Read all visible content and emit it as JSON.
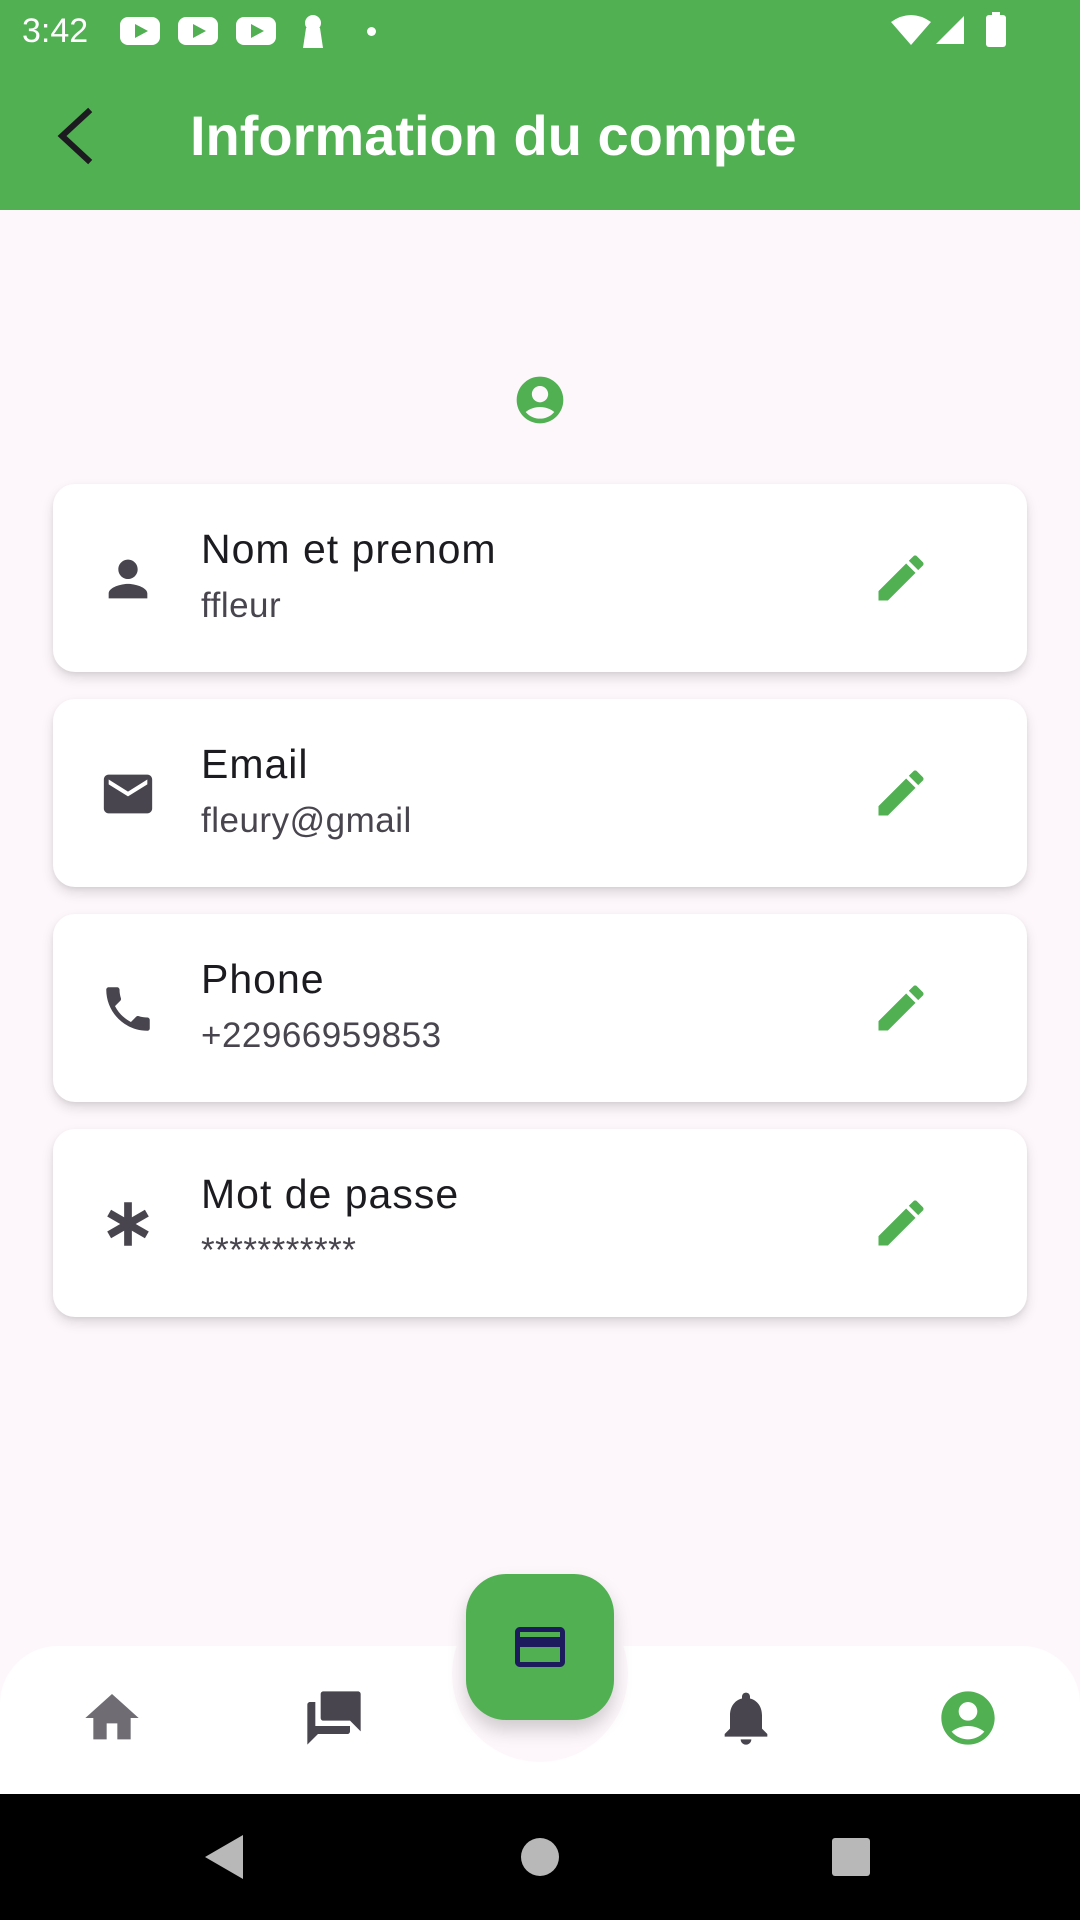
{
  "status_bar": {
    "time": "3:42"
  },
  "app_bar": {
    "title": "Information du compte"
  },
  "account_fields": [
    {
      "label": "Nom et prenom",
      "value": "ffleur",
      "icon": "person-icon"
    },
    {
      "label": "Email",
      "value": "fleury@gmail",
      "icon": "mail-icon"
    },
    {
      "label": "Phone",
      "value": "+22966959853",
      "icon": "phone-icon"
    },
    {
      "label": "Mot de passe",
      "value": "***********",
      "icon": "asterisk-icon"
    }
  ],
  "bottom_nav": {
    "items": [
      "home-icon",
      "chat-icon",
      "card-icon",
      "bell-icon",
      "account-icon"
    ],
    "active": "account-icon"
  },
  "colors": {
    "primary": "#50B052",
    "background": "#FDF7FB",
    "icon_dark": "#49454F",
    "fab_icon": "#1D1B5E"
  }
}
